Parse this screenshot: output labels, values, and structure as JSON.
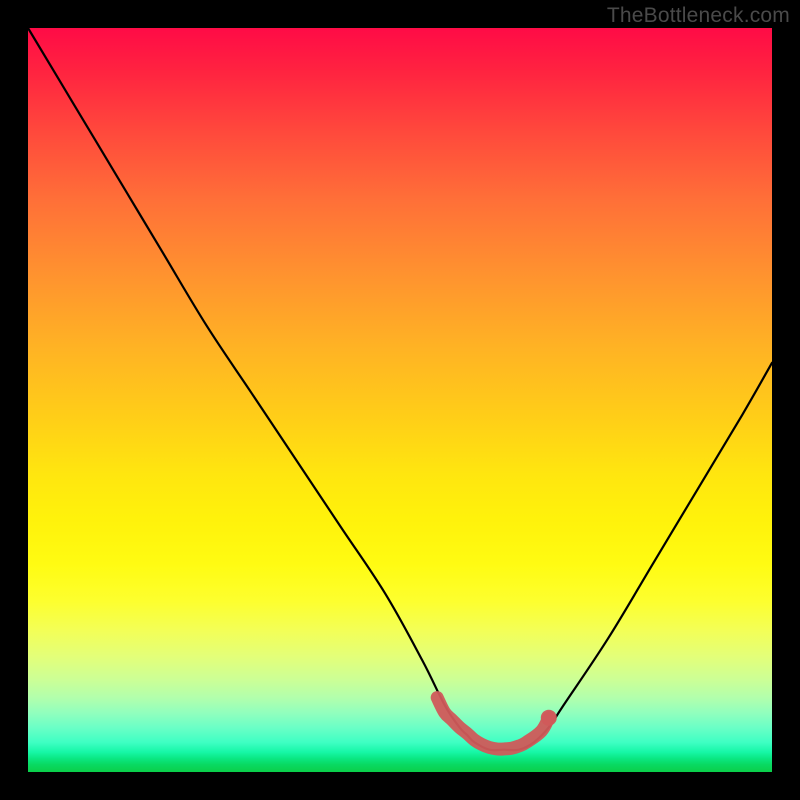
{
  "watermark": "TheBottleneck.com",
  "chart_data": {
    "type": "line",
    "title": "",
    "xlabel": "",
    "ylabel": "",
    "xlim": [
      0,
      100
    ],
    "ylim": [
      0,
      100
    ],
    "grid": false,
    "legend": false,
    "series": [
      {
        "name": "black-curve",
        "color": "#000000",
        "x": [
          0,
          6,
          12,
          18,
          24,
          30,
          36,
          42,
          48,
          53,
          56,
          58,
          59,
          60,
          62,
          64,
          66,
          68,
          70,
          72,
          78,
          84,
          90,
          96,
          100
        ],
        "y": [
          100,
          90,
          80,
          70,
          60,
          51,
          42,
          33,
          24,
          15,
          9,
          6,
          5,
          4,
          3,
          3,
          3,
          4,
          6,
          9,
          18,
          28,
          38,
          48,
          55
        ]
      },
      {
        "name": "red-overlay",
        "color": "#d05a5a",
        "x": [
          55,
          56,
          57,
          58,
          59,
          60,
          61,
          62,
          63,
          64,
          65,
          66,
          67,
          69,
          70
        ],
        "y": [
          10,
          8,
          7,
          6,
          5.2,
          4.3,
          3.7,
          3.3,
          3.1,
          3.1,
          3.2,
          3.5,
          4.0,
          5.5,
          7.3
        ]
      }
    ],
    "annotations": [
      {
        "name": "red-dot",
        "x": 70,
        "y": 7.3,
        "color": "#d05a5a"
      }
    ]
  }
}
